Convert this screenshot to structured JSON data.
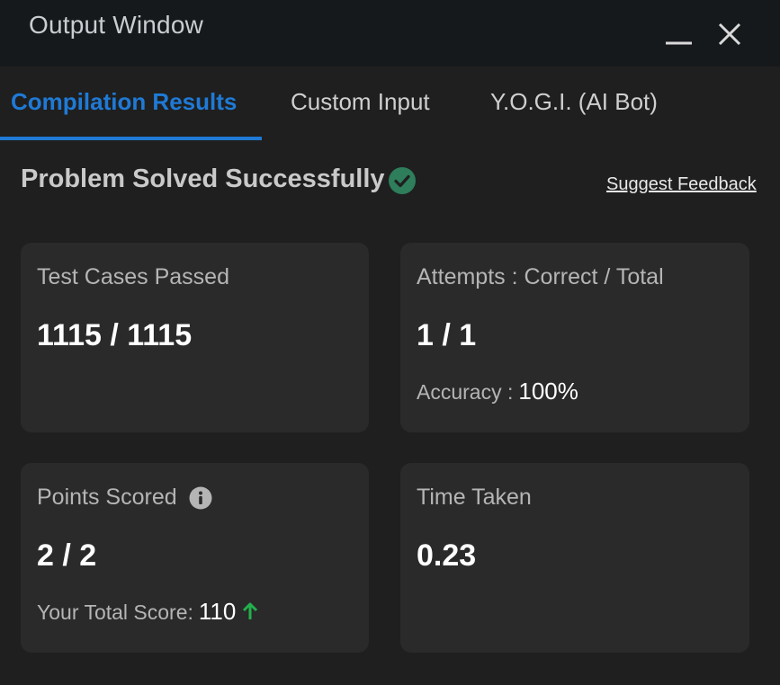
{
  "window": {
    "title": "Output Window",
    "minimize_icon": "minimize-icon",
    "close_icon": "close-icon"
  },
  "tabs": [
    {
      "label": "Compilation Results",
      "active": true
    },
    {
      "label": "Custom Input",
      "active": false
    },
    {
      "label": "Y.O.G.I. (AI Bot)",
      "active": false
    }
  ],
  "status": {
    "text": "Problem Solved Successfully",
    "icon": "check-circle-icon",
    "icon_color": "#2e7d5b"
  },
  "feedback_link": "Suggest Feedback",
  "cards": {
    "test_cases": {
      "label": "Test Cases Passed",
      "value": "1115 / 1115"
    },
    "attempts": {
      "label": "Attempts : Correct / Total",
      "value": "1 / 1",
      "accuracy_label": "Accuracy :",
      "accuracy_value": "100%"
    },
    "points": {
      "label": "Points Scored",
      "info_icon": "info-icon",
      "value": "2 / 2",
      "total_label": "Your Total Score:",
      "total_value": "110",
      "trend_icon": "arrow-up-icon",
      "trend_color": "#22b14c"
    },
    "time": {
      "label": "Time Taken",
      "value": "0.23"
    }
  },
  "colors": {
    "accent": "#1f7ad6",
    "background": "#1f1f1f",
    "titlebar": "#16191c",
    "card": "#2a2a2a"
  }
}
